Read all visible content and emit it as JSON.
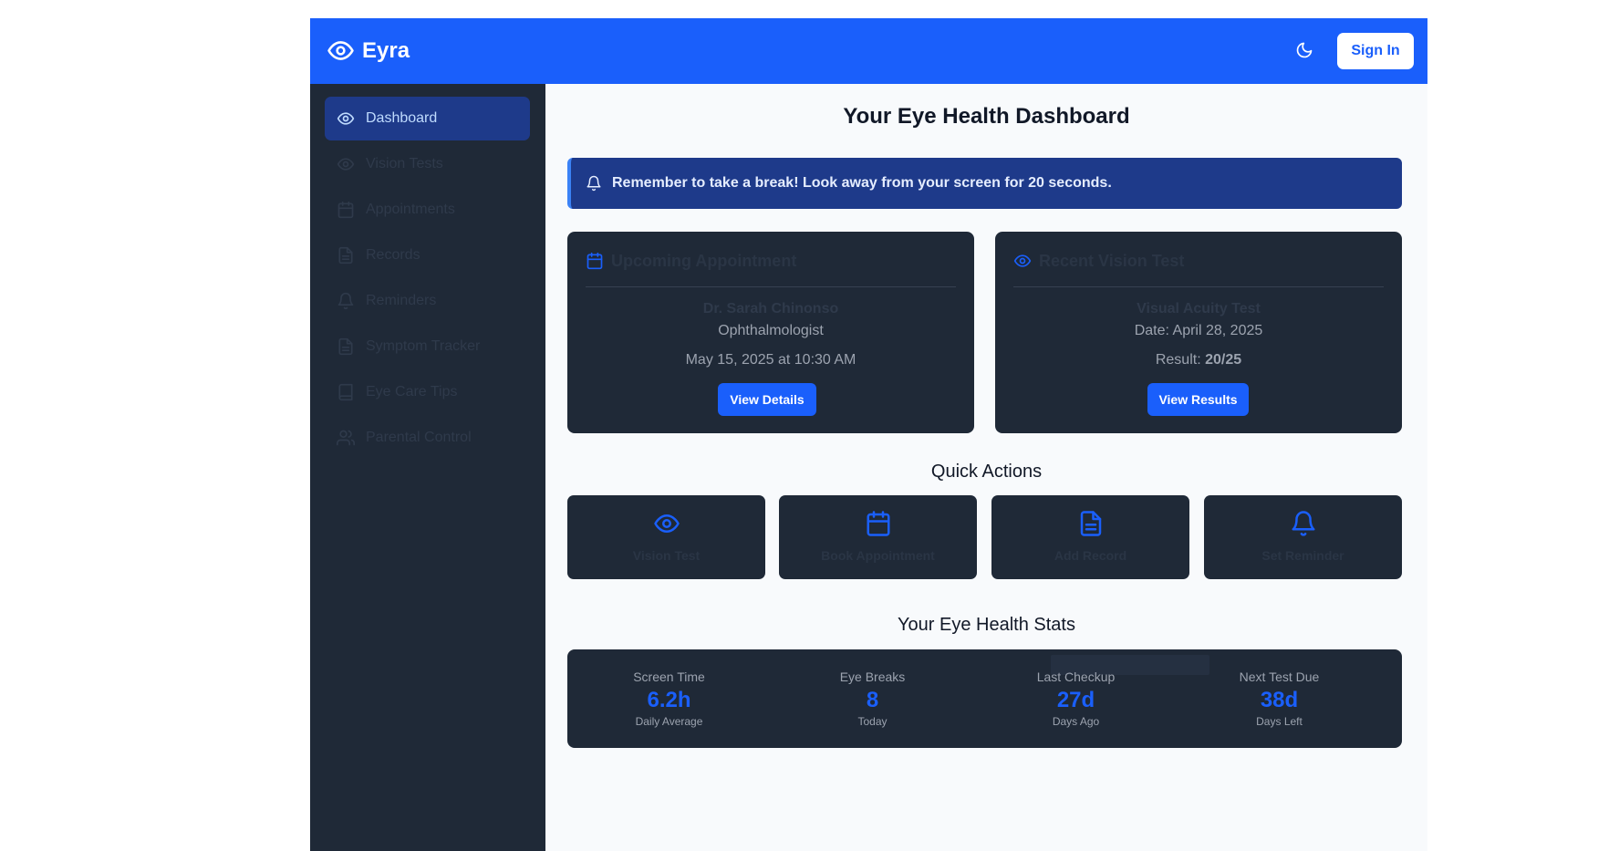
{
  "header": {
    "app_name": "Eyra",
    "logo_icon": "eye-icon",
    "theme_toggle_icon": "moon-icon",
    "sign_in_label": "Sign In",
    "brand_color": "#1a5ffb"
  },
  "sidebar": {
    "items": [
      {
        "label": "Dashboard",
        "icon": "eye-icon",
        "active": true
      },
      {
        "label": "Vision Tests",
        "icon": "eye-icon"
      },
      {
        "label": "Appointments",
        "icon": "calendar-icon"
      },
      {
        "label": "Records",
        "icon": "file-icon"
      },
      {
        "label": "Reminders",
        "icon": "bell-icon"
      },
      {
        "label": "Symptom Tracker",
        "icon": "file-icon"
      },
      {
        "label": "Eye Care Tips",
        "icon": "book-icon"
      },
      {
        "label": "Parental Control",
        "icon": "users-icon"
      }
    ]
  },
  "main": {
    "title": "Your Eye Health Dashboard",
    "banner": {
      "icon": "bell-icon",
      "text": "Remember to take a break! Look away from your screen for 20 seconds."
    },
    "appointment_card": {
      "icon": "calendar-icon",
      "title": "Upcoming Appointment",
      "doctor": "Dr. Sarah Chinonso",
      "specialty": "Ophthalmologist",
      "datetime": "May 15, 2025 at 10:30 AM",
      "button_label": "View Details"
    },
    "vision_card": {
      "icon": "eye-icon",
      "title": "Recent Vision Test",
      "test_name": "Visual Acuity Test",
      "date_text": "Date: April 28, 2025",
      "result_label": "Result: ",
      "result_value": "20/25",
      "button_label": "View Results"
    },
    "quick_actions": {
      "title": "Quick Actions",
      "items": [
        {
          "label": "Vision Test",
          "icon": "eye-icon"
        },
        {
          "label": "Book Appointment",
          "icon": "calendar-icon"
        },
        {
          "label": "Add Record",
          "icon": "file-icon"
        },
        {
          "label": "Set Reminder",
          "icon": "bell-icon"
        }
      ]
    },
    "stats": {
      "title": "Your Eye Health Stats",
      "items": [
        {
          "label": "Screen Time",
          "value": "6.2h",
          "sub": "Daily Average"
        },
        {
          "label": "Eye Breaks",
          "value": "8",
          "sub": "Today"
        },
        {
          "label": "Last Checkup",
          "value": "27d",
          "sub": "Days Ago"
        },
        {
          "label": "Next Test Due",
          "value": "38d",
          "sub": "Days Left"
        }
      ]
    }
  }
}
